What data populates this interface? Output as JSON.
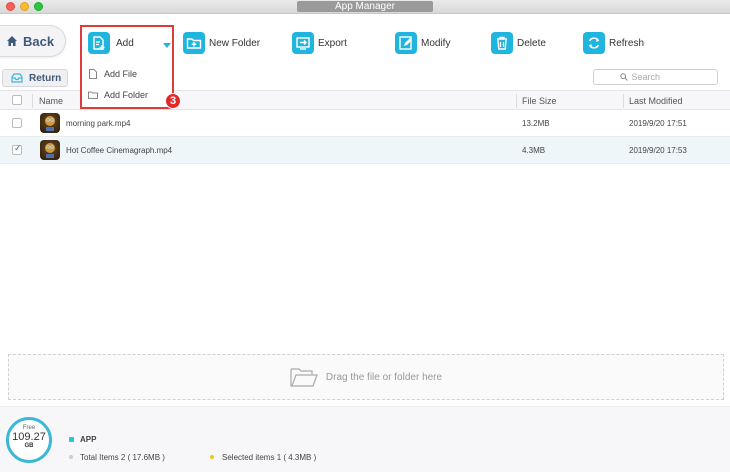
{
  "window": {
    "title": "App Manager"
  },
  "toolbar": {
    "back_label": "Back",
    "add_label": "Add",
    "new_folder_label": "New Folder",
    "export_label": "Export",
    "modify_label": "Modify",
    "delete_label": "Delete",
    "refresh_label": "Refresh",
    "accent_color": "#1fb5de"
  },
  "add_menu": {
    "items": [
      {
        "label": "Add File",
        "icon": "file-icon"
      },
      {
        "label": "Add Folder",
        "icon": "folder-icon"
      }
    ],
    "step_badge": "3"
  },
  "subbar": {
    "return_label": "Return",
    "search_placeholder": "Search"
  },
  "table": {
    "columns": [
      "Name",
      "File Size",
      "Last Modified"
    ],
    "rows": [
      {
        "name": "morning park.mp4",
        "size": "13.2MB",
        "modified": "2019/9/20  17:51",
        "checked": false
      },
      {
        "name": "Hot Coffee Cinemagraph.mp4",
        "size": "4.3MB",
        "modified": "2019/9/20  17:53",
        "checked": true
      }
    ]
  },
  "dropzone": {
    "text": "Drag the file or folder here"
  },
  "footer": {
    "free_label": "Free",
    "free_value": "109.27",
    "free_unit": "GB",
    "category_label": "APP",
    "total_items": "Total Items 2 ( 17.6MB )",
    "selected_items": "Selected items 1 ( 4.3MB )",
    "app_color": "#2ec4d6",
    "total_dot_color": "#cccccc",
    "selected_dot_color": "#f5c518"
  }
}
